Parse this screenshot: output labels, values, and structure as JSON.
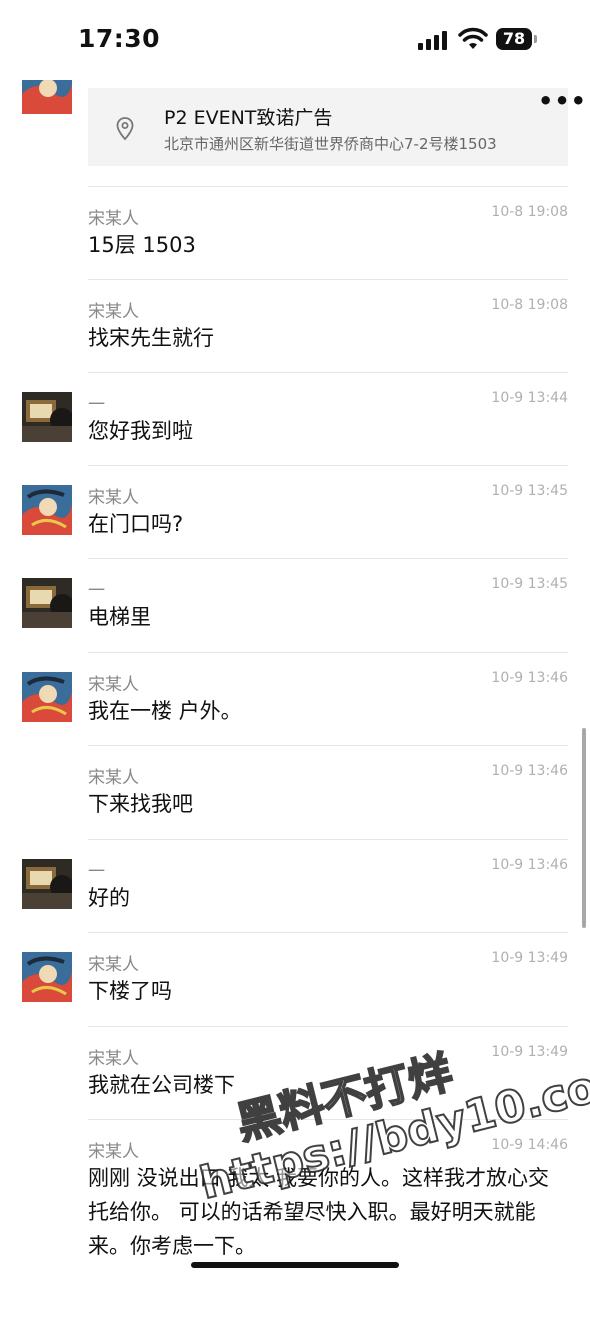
{
  "status": {
    "time": "17:30",
    "battery": "78"
  },
  "location": {
    "title": "P2 EVENT致诺广告",
    "address": "北京市通州区新华街道世界侨商中心7-2号楼1503"
  },
  "messages": [
    {
      "sender": "宋某人",
      "time": "10-8 19:08",
      "text": "15层 1503",
      "avatar": "none"
    },
    {
      "sender": "宋某人",
      "time": "10-8 19:08",
      "text": "找宋先生就行",
      "avatar": "none"
    },
    {
      "sender": "一",
      "time": "10-9 13:44",
      "text": "您好我到啦",
      "avatar": "photo"
    },
    {
      "sender": "宋某人",
      "time": "10-9 13:45",
      "text": "在门口吗?",
      "avatar": "illustration"
    },
    {
      "sender": "一",
      "time": "10-9 13:45",
      "text": "电梯里",
      "avatar": "photo"
    },
    {
      "sender": "宋某人",
      "time": "10-9 13:46",
      "text": "我在一楼 户外。",
      "avatar": "illustration"
    },
    {
      "sender": "宋某人",
      "time": "10-9 13:46",
      "text": "下来找我吧",
      "avatar": "none"
    },
    {
      "sender": "一",
      "time": "10-9 13:46",
      "text": "好的",
      "avatar": "photo"
    },
    {
      "sender": "宋某人",
      "time": "10-9 13:49",
      "text": "下楼了吗",
      "avatar": "illustration"
    },
    {
      "sender": "宋某人",
      "time": "10-9 13:49",
      "text": "我就在公司楼下",
      "avatar": "none"
    },
    {
      "sender": "宋某人",
      "time": "10-9 14:46",
      "text": "刚刚 没说出口 我太 我要你的人。这样我才放心交托给你。 可以的话希望尽快入职。最好明天就能来。你考虑一下。",
      "avatar": "none"
    }
  ],
  "watermark": {
    "line1": "黑料不打烊",
    "line2": "https://bdy10.co"
  },
  "icons": {
    "location": "location-pin-icon",
    "more": "more-dots-icon"
  }
}
